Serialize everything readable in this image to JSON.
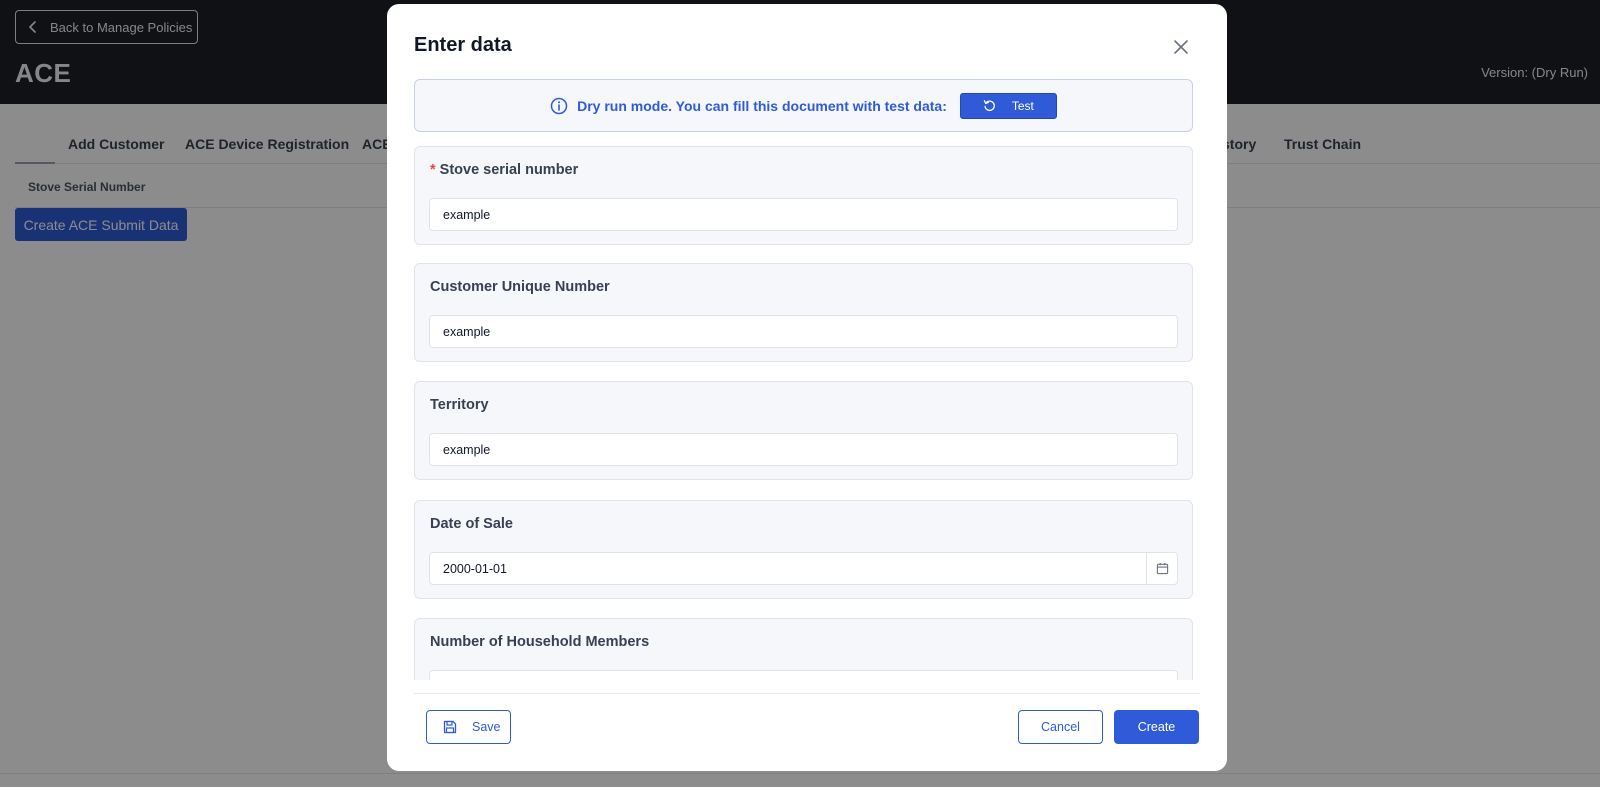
{
  "header": {
    "back_label": "Back to Manage Policies",
    "title": "ACE",
    "version": "Version: (Dry Run)"
  },
  "tabs": [
    {
      "label": "Add Customer"
    },
    {
      "label": "ACE Device Registration"
    },
    {
      "label": "ACE"
    },
    {
      "label": "story"
    },
    {
      "label": "Trust Chain"
    }
  ],
  "table": {
    "column_header": "Stove Serial Number"
  },
  "page": {
    "create_button": "Create ACE Submit Data"
  },
  "modal": {
    "title": "Enter data",
    "info_text": "Dry run mode. You can fill this document with test data:",
    "test_button": "Test",
    "fields": [
      {
        "label": "Stove serial number",
        "required_mark": "*",
        "value": "example"
      },
      {
        "label": "Customer Unique Number",
        "value": "example"
      },
      {
        "label": "Territory",
        "value": "example"
      },
      {
        "label": "Date of Sale",
        "value": "2000-01-01"
      },
      {
        "label": "Number of Household Members",
        "value": ""
      }
    ],
    "save_button": "Save",
    "cancel_button": "Cancel",
    "create_button": "Create"
  },
  "colors": {
    "accent": "#2f5bd8",
    "topbar": "#1c1f26",
    "required": "#ef4444"
  },
  "icons": [
    "chevron-left-icon",
    "close-icon",
    "info-icon",
    "refresh-icon",
    "calendar-icon",
    "save-icon"
  ]
}
